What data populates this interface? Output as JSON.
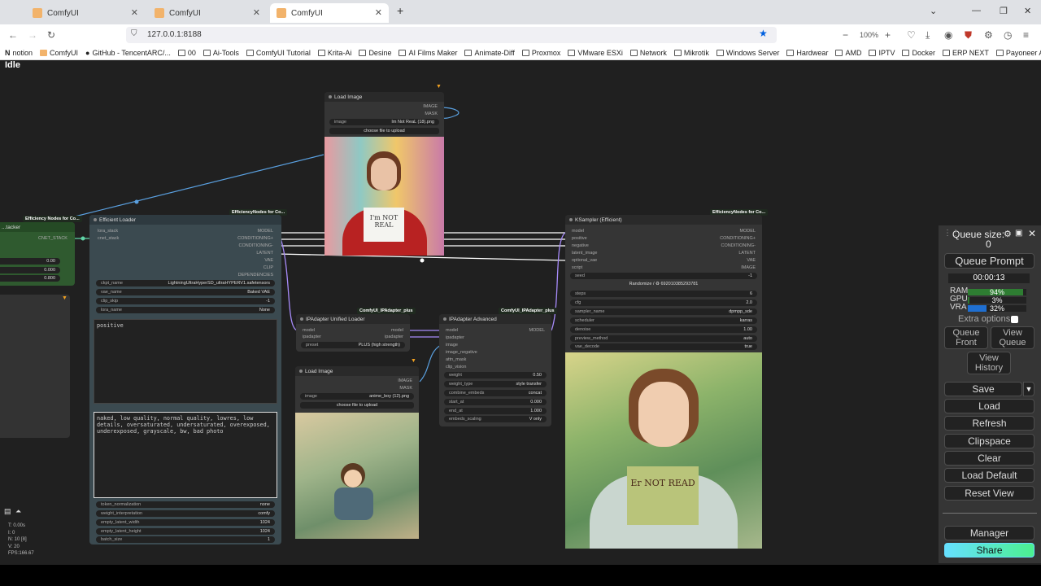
{
  "tabs": [
    {
      "label": "ComfyUI",
      "active": false
    },
    {
      "label": "ComfyUI",
      "active": false
    },
    {
      "label": "ComfyUI",
      "active": true
    }
  ],
  "url": "127.0.0.1:8188",
  "zoom": "100%",
  "bookmarks": [
    "notion",
    "ComfyUI",
    "GitHub - TencentARC/...",
    "00",
    "Ai-Tools",
    "ComfyUI Tutorial",
    "Krita-Ai",
    "Desine",
    "AI Films Maker",
    "Animate-Diff",
    "Proxmox",
    "VMware ESXi",
    "Network",
    "Mikrotik",
    "Windows Server",
    "Hardwear",
    "AMD",
    "IPTV",
    "Docker",
    "ERP NEXT",
    "Payoneer Acc"
  ],
  "status": "Idle",
  "nodes": {
    "stacker": {
      "badge": "Efficiency Nodes for Co...",
      "title": "...tacker",
      "output": "CNET_STACK",
      "values": [
        "0.00",
        "0.000",
        "0.800"
      ]
    },
    "loader": {
      "badge": "EfficiencyNodes for Co...",
      "title": "Efficient Loader",
      "inputs": [
        "lora_stack",
        "cnet_stack"
      ],
      "outputs": [
        "MODEL",
        "CONDITIONING+",
        "CONDITIONING-",
        "LATENT",
        "VAE",
        "CLIP",
        "DEPENDENCIES"
      ],
      "widgets": [
        {
          "name": "ckpt_name",
          "value": "LightningUltraHyperSD_ultraHYPERV1.safetensors"
        },
        {
          "name": "vae_name",
          "value": "Baked VAE"
        },
        {
          "name": "clip_skip",
          "value": "-1"
        },
        {
          "name": "lora_name",
          "value": "None"
        }
      ],
      "positive": "positive",
      "negative": "naked, low quality, normal quality, lowres, low details, oversaturated, undersaturated, overexposed, underexposed, grayscale, bw, bad photo",
      "widgets2": [
        {
          "name": "token_normalization",
          "value": "none"
        },
        {
          "name": "weight_interpretation",
          "value": "comfy"
        },
        {
          "name": "empty_latent_width",
          "value": "1024"
        },
        {
          "name": "empty_latent_height",
          "value": "1024"
        },
        {
          "name": "batch_size",
          "value": "1"
        }
      ]
    },
    "loadImage1": {
      "title": "Load Image",
      "outputs": [
        "IMAGE",
        "MASK"
      ],
      "image_label": "image",
      "image_value": "Im Not ReaL (18).png",
      "upload": "choose file to upload",
      "sign_text": "I'm NOT REAL"
    },
    "ipaUnified": {
      "badge": "ComfyUI_IPAdapter_plus",
      "title": "IPAdapter Unified Loader",
      "inputs": [
        "model",
        "ipadapter"
      ],
      "outputs": [
        "model",
        "ipadapter"
      ],
      "preset_label": "preset",
      "preset_value": "PLUS (high strength)"
    },
    "loadImage2": {
      "title": "Load Image",
      "outputs": [
        "IMAGE",
        "MASK"
      ],
      "image_label": "image",
      "image_value": "anime_boy (12).png",
      "upload": "choose file to upload"
    },
    "ipaAdvanced": {
      "badge": "ComfyUI_IPAdapter_plus",
      "title": "IPAdapter Advanced",
      "inputs": [
        "model",
        "ipadapter",
        "image",
        "image_negative",
        "attn_mask",
        "clip_vision"
      ],
      "output": "MODEL",
      "widgets": [
        {
          "name": "weight",
          "value": "0.50"
        },
        {
          "name": "weight_type",
          "value": "style transfer"
        },
        {
          "name": "combine_embeds",
          "value": "concat"
        },
        {
          "name": "start_at",
          "value": "0.000"
        },
        {
          "name": "end_at",
          "value": "1.000"
        },
        {
          "name": "embeds_scaling",
          "value": "V only"
        }
      ]
    },
    "ksampler": {
      "badge": "EfficiencyNodes for Co...",
      "title": "KSampler (Efficient)",
      "inputs": [
        "model",
        "positive",
        "negative",
        "latent_image",
        "optional_vae",
        "script"
      ],
      "outputs": [
        "MODEL",
        "CONDITIONING+",
        "CONDITIONING-",
        "LATENT",
        "VAE",
        "IMAGE"
      ],
      "seed": {
        "name": "seed",
        "value": "-1"
      },
      "randomize": "Randomize / ♻ 692010385293781",
      "widgets": [
        {
          "name": "steps",
          "value": "6"
        },
        {
          "name": "cfg",
          "value": "2.0"
        },
        {
          "name": "sampler_name",
          "value": "dpmpp_sde"
        },
        {
          "name": "scheduler",
          "value": "karras"
        },
        {
          "name": "denoise",
          "value": "1.00"
        },
        {
          "name": "preview_method",
          "value": "auto"
        },
        {
          "name": "vae_decode",
          "value": "true"
        }
      ],
      "sign_text": "Er NOT READ"
    }
  },
  "panel": {
    "queue_size_label": "Queue size:",
    "queue_size": "0",
    "queue_prompt": "Queue Prompt",
    "timer": "00:00:13",
    "ram_label": "RAM",
    "ram": "94%",
    "ram_fraction": 0.94,
    "gpu_label": "GPU",
    "gpu": "3%",
    "gpu_fraction": 0.03,
    "vram_label": "VRA",
    "vram": "32%",
    "vram_fraction": 0.32,
    "extra_options": "Extra options",
    "queue_front": "Queue Front",
    "view_queue": "View Queue",
    "view_history": "View History",
    "save": "Save",
    "load": "Load",
    "refresh": "Refresh",
    "clipspace": "Clipspace",
    "clear": "Clear",
    "load_default": "Load Default",
    "reset_view": "Reset View",
    "manager": "Manager",
    "share": "Share"
  },
  "stats": [
    "T: 0.00s",
    "I: 0",
    "N: 10 [8]",
    "V: 20",
    "FPS:166.67"
  ],
  "colors": {
    "accent_green": "#2e7d32",
    "link_blue": "#5aa0e0",
    "share_gradient": "#66e0ff"
  }
}
